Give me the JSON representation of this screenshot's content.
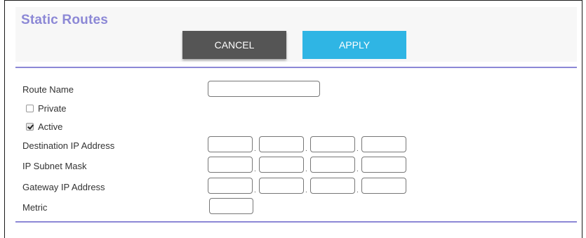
{
  "header": {
    "title": "Static Routes",
    "cancel_label": "CANCEL",
    "apply_label": "APPLY"
  },
  "form": {
    "route_name_label": "Route Name",
    "route_name_value": "",
    "private_label": "Private",
    "private_checked": false,
    "active_label": "Active",
    "active_checked": true,
    "destination_ip_label": "Destination IP Address",
    "subnet_mask_label": "IP Subnet Mask",
    "gateway_ip_label": "Gateway IP Address",
    "metric_label": "Metric",
    "metric_value": "",
    "ip_separator": "."
  },
  "colors": {
    "title": "#8c88d6",
    "cancel_bg": "#555555",
    "apply_bg": "#2fb5e4",
    "rule": "#8c88d6"
  }
}
